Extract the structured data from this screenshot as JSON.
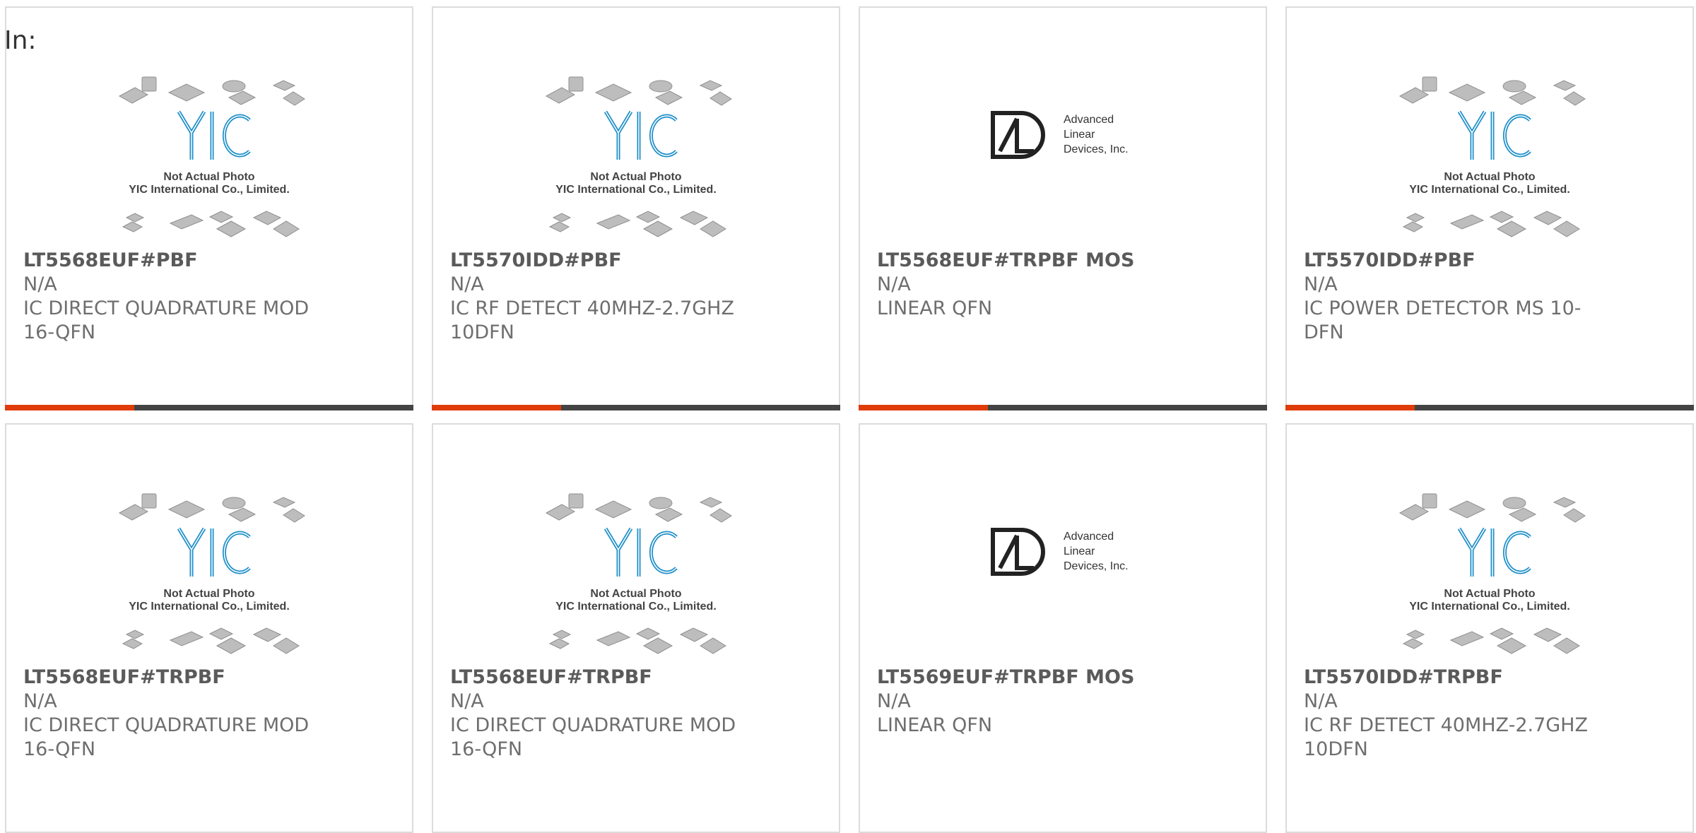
{
  "page": {
    "label": "In:"
  },
  "colors": {
    "accent": "#e03c0a",
    "bar_dark": "#444444",
    "border": "#dcdcdc",
    "yic_blue": "#1f8fc9"
  },
  "images": {
    "yic": {
      "caption_line1": "Not Actual Photo",
      "caption_line2": "YIC International Co., Limited."
    },
    "ald": {
      "line1": "Advanced",
      "line2": "Linear",
      "line3": "Devices, Inc."
    }
  },
  "products": [
    {
      "name": "LT5568EUF#PBF",
      "manufacturer": "N/A",
      "description": "IC DIRECT QUADRATURE MOD 16-QFN",
      "image": "yic-placeholder"
    },
    {
      "name": "LT5570IDD#PBF",
      "manufacturer": "N/A",
      "description": "IC RF DETECT 40MHZ-2.7GHZ 10DFN",
      "image": "yic-placeholder"
    },
    {
      "name": "LT5568EUF#TRPBF MOS",
      "manufacturer": "N/A",
      "description": "LINEAR QFN",
      "image": "ald-logo"
    },
    {
      "name": "LT5570IDD#PBF",
      "manufacturer": "N/A",
      "description": "IC POWER DETECTOR MS 10-DFN",
      "image": "yic-placeholder"
    },
    {
      "name": "LT5568EUF#TRPBF",
      "manufacturer": "N/A",
      "description": "IC DIRECT QUADRATURE MOD 16-QFN",
      "image": "yic-placeholder"
    },
    {
      "name": "LT5568EUF#TRPBF",
      "manufacturer": "N/A",
      "description": "IC DIRECT QUADRATURE MOD 16-QFN",
      "image": "yic-placeholder"
    },
    {
      "name": "LT5569EUF#TRPBF MOS",
      "manufacturer": "N/A",
      "description": "LINEAR QFN",
      "image": "ald-logo"
    },
    {
      "name": "LT5570IDD#TRPBF",
      "manufacturer": "N/A",
      "description": "IC RF DETECT 40MHZ-2.7GHZ 10DFN",
      "image": "yic-placeholder"
    }
  ]
}
